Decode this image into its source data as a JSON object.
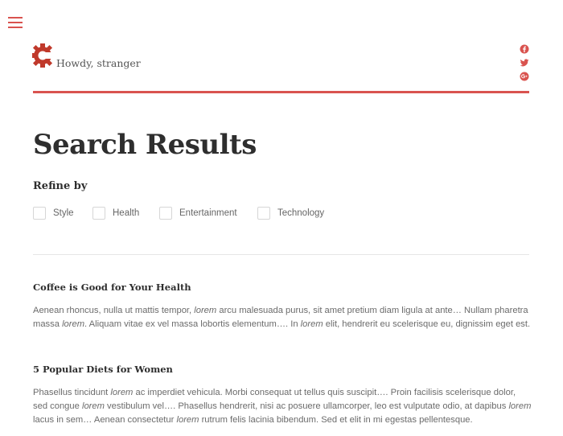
{
  "header": {
    "greeting": "Howdy, stranger",
    "menu_icon": "hamburger-menu-icon",
    "logo_icon": "gear-c-logo",
    "social_icons": [
      "facebook-icon",
      "twitter-icon",
      "google-plus-icon"
    ],
    "accent_color": "#d9534f"
  },
  "page": {
    "title": "Search Results"
  },
  "refine": {
    "heading": "Refine by",
    "options": [
      {
        "label": "Style",
        "checked": false
      },
      {
        "label": "Health",
        "checked": false
      },
      {
        "label": "Entertainment",
        "checked": false
      },
      {
        "label": "Technology",
        "checked": false
      }
    ]
  },
  "results": [
    {
      "title": "Coffee is Good for Your Health",
      "excerpt_parts": [
        {
          "text": "Aenean rhoncus, nulla ut mattis tempor, ",
          "em": false
        },
        {
          "text": "lorem",
          "em": true
        },
        {
          "text": " arcu malesuada purus, sit amet pretium diam ligula at ante… Nullam pharetra massa ",
          "em": false
        },
        {
          "text": "lorem",
          "em": true
        },
        {
          "text": ". Aliquam vitae ex vel massa lobortis elementum…. In ",
          "em": false
        },
        {
          "text": "lorem",
          "em": true
        },
        {
          "text": " elit, hendrerit eu scelerisque eu, dignissim eget est.",
          "em": false
        }
      ]
    },
    {
      "title": "5 Popular Diets for Women",
      "excerpt_parts": [
        {
          "text": "Phasellus tincidunt ",
          "em": false
        },
        {
          "text": "lorem",
          "em": true
        },
        {
          "text": " ac imperdiet vehicula. Morbi consequat ut tellus quis suscipit…. Proin facilisis scelerisque dolor, sed congue ",
          "em": false
        },
        {
          "text": "lorem",
          "em": true
        },
        {
          "text": " vestibulum vel…. Phasellus hendrerit, nisi ac posuere ullamcorper, leo est vulputate odio, at dapibus ",
          "em": false
        },
        {
          "text": "lorem",
          "em": true
        },
        {
          "text": " lacus in sem… Aenean consectetur ",
          "em": false
        },
        {
          "text": "lorem",
          "em": true
        },
        {
          "text": " rutrum felis lacinia bibendum. Sed et elit in mi egestas pellentesque.",
          "em": false
        }
      ]
    }
  ]
}
